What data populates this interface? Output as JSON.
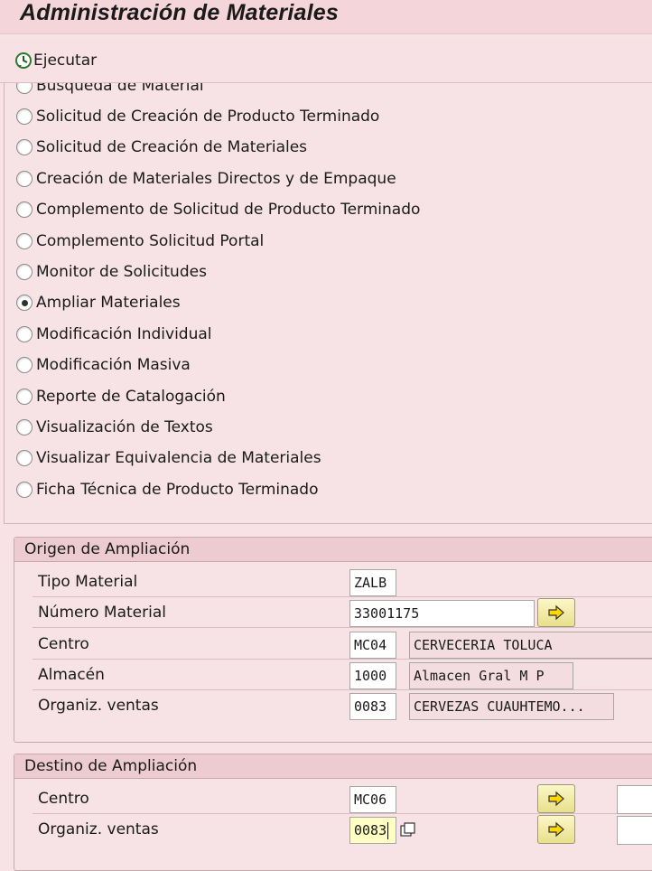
{
  "window": {
    "title": "Administración de Materiales"
  },
  "toolbar": {
    "execute_label": "Ejecutar"
  },
  "options": [
    {
      "label": "Búsqueda de Material",
      "checked": false
    },
    {
      "label": "Solicitud de Creación de Producto Terminado",
      "checked": false
    },
    {
      "label": "Solicitud de Creación de Materiales",
      "checked": false
    },
    {
      "label": "Creación de Materiales Directos y de Empaque",
      "checked": false
    },
    {
      "label": "Complemento de Solicitud de Producto Terminado",
      "checked": false
    },
    {
      "label": "Complemento Solicitud Portal",
      "checked": false
    },
    {
      "label": "Monitor de Solicitudes",
      "checked": false
    },
    {
      "label": "Ampliar Materiales",
      "checked": true
    },
    {
      "label": "Modificación Individual",
      "checked": false
    },
    {
      "label": "Modificación Masiva",
      "checked": false
    },
    {
      "label": "Reporte de Catalogación",
      "checked": false
    },
    {
      "label": "Visualización de Textos",
      "checked": false
    },
    {
      "label": "Visualizar Equivalencia de Materiales",
      "checked": false
    },
    {
      "label": "Ficha Técnica de Producto Terminado",
      "checked": false
    }
  ],
  "origen": {
    "title": "Origen de Ampliación",
    "tipo_material": {
      "label": "Tipo Material",
      "value": "ZALB"
    },
    "numero_material": {
      "label": "Número Material",
      "value": "33001175"
    },
    "centro": {
      "label": "Centro",
      "value": "MC04",
      "desc": "CERVECERIA TOLUCA"
    },
    "almacen": {
      "label": "Almacén",
      "value": "1000",
      "desc": "Almacen Gral M P"
    },
    "org_ventas": {
      "label": "Organiz. ventas",
      "value": "0083",
      "desc": "CERVEZAS CUAUHTEMO..."
    }
  },
  "destino": {
    "title": "Destino de Ampliación",
    "centro": {
      "label": "Centro",
      "value": "MC06"
    },
    "org_ventas": {
      "label": "Organiz. ventas",
      "value": "0083"
    }
  },
  "colors": {
    "background": "#f7e3e6",
    "header": "#f3d5da",
    "group_title": "#ecccd1",
    "input_focus": "#ffffc4",
    "arrow_button": "#e8e08a"
  },
  "icons": {
    "execute": "execute-clock-icon",
    "arrow": "yellow-arrow-right-icon",
    "f4": "value-help-icon"
  }
}
